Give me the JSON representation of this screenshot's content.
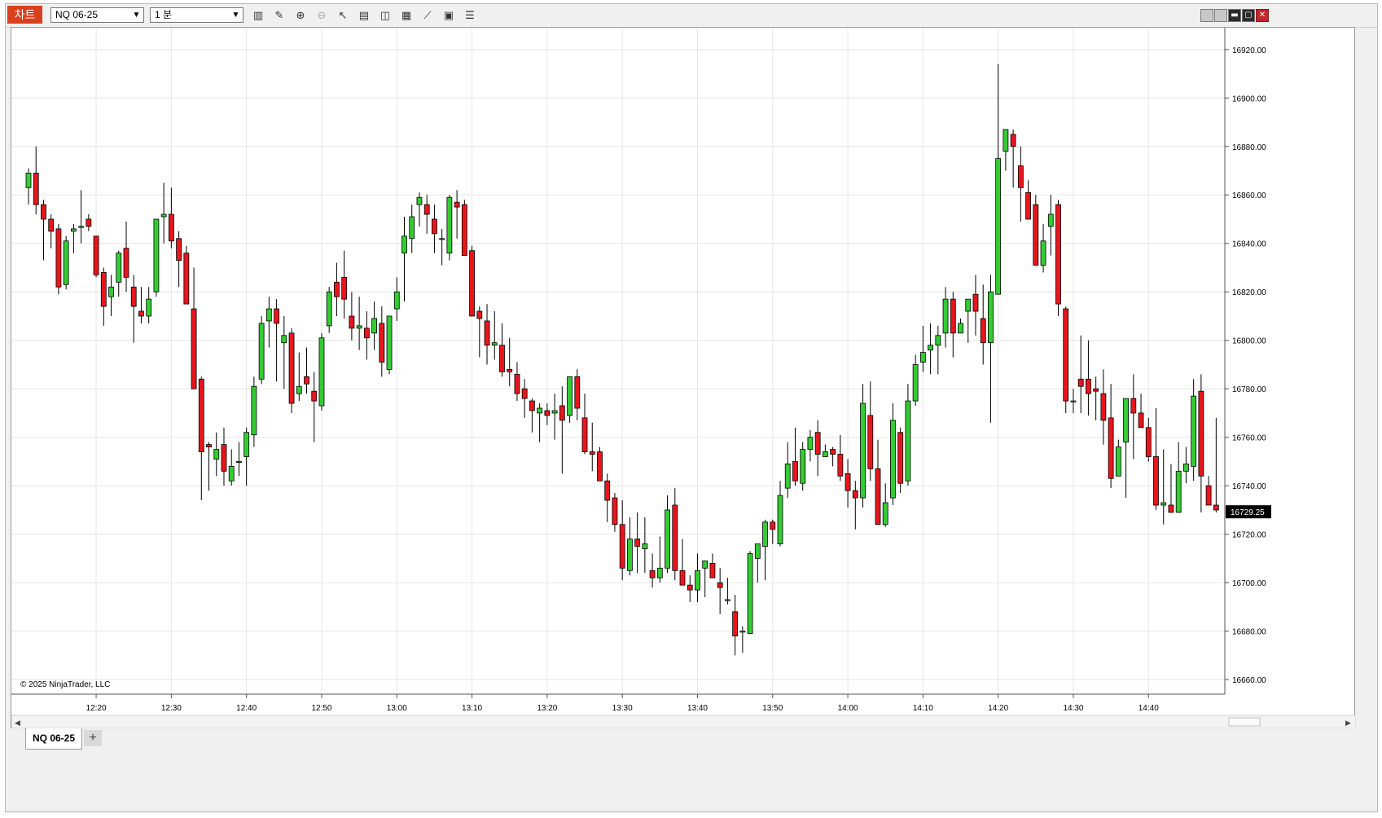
{
  "toolbar": {
    "brand_label": "차트",
    "instrument": "NQ 06-25",
    "interval": "1 분",
    "icons": [
      "bar-type-icon",
      "pencil-icon",
      "zoom-in-icon",
      "zoom-out-icon",
      "pointer-icon",
      "data-box-icon",
      "indicators-icon",
      "strategies-icon",
      "drawing-tools-icon",
      "properties-icon",
      "list-icon"
    ]
  },
  "window_controls": [
    "minimize-icon",
    "restore-icon",
    "maximize-icon",
    "close-icon"
  ],
  "tab": {
    "label": "NQ 06-25",
    "add_label": "+"
  },
  "copyright": "© 2025 NinjaTrader, LLC",
  "colors": {
    "up": "#33cc33",
    "down": "#e8161c",
    "price_marker": "#000000"
  },
  "chart_data": {
    "type": "candlestick",
    "instrument": "NQ 06-25",
    "interval": "1 분",
    "last_price": "16729.25",
    "ylim": [
      16654,
      16929
    ],
    "y_ticks": [
      "16660.00",
      "16680.00",
      "16700.00",
      "16720.00",
      "16740.00",
      "16760.00",
      "16780.00",
      "16800.00",
      "16820.00",
      "16840.00",
      "16860.00",
      "16880.00",
      "16900.00",
      "16920.00"
    ],
    "x_ticks": [
      "12:20",
      "12:30",
      "12:40",
      "12:50",
      "13:00",
      "13:10",
      "13:20",
      "13:30",
      "13:40",
      "13:50",
      "14:00",
      "14:10",
      "14:20",
      "14:30",
      "14:40"
    ],
    "x_tick_index": [
      9,
      19,
      29,
      39,
      49,
      59,
      69,
      79,
      89,
      99,
      109,
      119,
      129,
      139,
      149
    ],
    "candles": [
      [
        16863,
        16871,
        16856,
        16869
      ],
      [
        16869,
        16880,
        16852,
        16856
      ],
      [
        16856,
        16858,
        16833,
        16850
      ],
      [
        16850,
        16852,
        16838,
        16845
      ],
      [
        16846,
        16848,
        16819,
        16822
      ],
      [
        16823,
        16843,
        16821,
        16841
      ],
      [
        16845,
        16848,
        16836,
        16846
      ],
      [
        16847,
        16862,
        16840,
        16847
      ],
      [
        16850,
        16852,
        16845,
        16847
      ],
      [
        16843,
        16843,
        16826,
        16827
      ],
      [
        16828,
        16830,
        16806,
        16814
      ],
      [
        16818,
        16827,
        16810,
        16822
      ],
      [
        16824,
        16837,
        16818,
        16836
      ],
      [
        16838,
        16849,
        16820,
        16826
      ],
      [
        16822,
        16827,
        16799,
        16814
      ],
      [
        16812,
        16822,
        16807,
        16810
      ],
      [
        16810,
        16822,
        16807,
        16817
      ],
      [
        16820,
        16850,
        16818,
        16850
      ],
      [
        16851,
        16865,
        16840,
        16852
      ],
      [
        16852,
        16863,
        16838,
        16841
      ],
      [
        16842,
        16845,
        16822,
        16833
      ],
      [
        16836,
        16839,
        16818,
        16815
      ],
      [
        16813,
        16830,
        16810,
        16780
      ],
      [
        16784,
        16785,
        16734,
        16754
      ],
      [
        16757,
        16758,
        16738,
        16756
      ],
      [
        16751,
        16762,
        16744,
        16755
      ],
      [
        16757,
        16764,
        16740,
        16746
      ],
      [
        16742,
        16755,
        16740,
        16748
      ],
      [
        16750,
        16758,
        16744,
        16750
      ],
      [
        16752,
        16764,
        16740,
        16762
      ],
      [
        16761,
        16785,
        16756,
        16781
      ],
      [
        16784,
        16810,
        16782,
        16807
      ],
      [
        16808,
        16818,
        16797,
        16813
      ],
      [
        16813,
        16817,
        16783,
        16807
      ],
      [
        16799,
        16810,
        16780,
        16802
      ],
      [
        16803,
        16805,
        16770,
        16774
      ],
      [
        16778,
        16795,
        16775,
        16781
      ],
      [
        16785,
        16797,
        16778,
        16782
      ],
      [
        16779,
        16787,
        16758,
        16775
      ],
      [
        16773,
        16803,
        16771,
        16801
      ],
      [
        16806,
        16822,
        16803,
        16820
      ],
      [
        16824,
        16832,
        16810,
        16818
      ],
      [
        16826,
        16837,
        16809,
        16817
      ],
      [
        16810,
        16820,
        16800,
        16805
      ],
      [
        16805,
        16818,
        16796,
        16806
      ],
      [
        16805,
        16812,
        16792,
        16801
      ],
      [
        16803,
        16816,
        16796,
        16809
      ],
      [
        16807,
        16814,
        16785,
        16791
      ],
      [
        16788,
        16810,
        16786,
        16810
      ],
      [
        16813,
        16826,
        16808,
        16820
      ],
      [
        16836,
        16851,
        16816,
        16843
      ],
      [
        16842,
        16856,
        16836,
        16851
      ],
      [
        16856,
        16861,
        16847,
        16859
      ],
      [
        16856,
        16860,
        16844,
        16852
      ],
      [
        16850,
        16856,
        16836,
        16844
      ],
      [
        16842,
        16846,
        16831,
        16842
      ],
      [
        16836,
        16860,
        16833,
        16859
      ],
      [
        16857,
        16862,
        16842,
        16855
      ],
      [
        16856,
        16858,
        16836,
        16835
      ],
      [
        16837,
        16839,
        16813,
        16810
      ],
      [
        16812,
        16814,
        16793,
        16809
      ],
      [
        16808,
        16815,
        16790,
        16798
      ],
      [
        16798,
        16812,
        16792,
        16799
      ],
      [
        16798,
        16807,
        16785,
        16787
      ],
      [
        16788,
        16801,
        16781,
        16787
      ],
      [
        16786,
        16791,
        16775,
        16778
      ],
      [
        16780,
        16784,
        16768,
        16776
      ],
      [
        16775,
        16776,
        16762,
        16771
      ],
      [
        16770,
        16774,
        16758,
        16772
      ],
      [
        16771,
        16774,
        16765,
        16769
      ],
      [
        16770,
        16778,
        16759,
        16771
      ],
      [
        16773,
        16781,
        16745,
        16767
      ],
      [
        16769,
        16785,
        16766,
        16785
      ],
      [
        16785,
        16788,
        16767,
        16772
      ],
      [
        16768,
        16778,
        16753,
        16754
      ],
      [
        16754,
        16766,
        16746,
        16753
      ],
      [
        16754,
        16756,
        16742,
        16742
      ],
      [
        16742,
        16745,
        16725,
        16734
      ],
      [
        16735,
        16737,
        16721,
        16724
      ],
      [
        16724,
        16734,
        16701,
        16706
      ],
      [
        16705,
        16727,
        16703,
        16718
      ],
      [
        16718,
        16729,
        16704,
        16715
      ],
      [
        16714,
        16727,
        16704,
        16716
      ],
      [
        16705,
        16712,
        16698,
        16702
      ],
      [
        16702,
        16719,
        16700,
        16706
      ],
      [
        16706,
        16736,
        16704,
        16730
      ],
      [
        16732,
        16739,
        16701,
        16705
      ],
      [
        16705,
        16718,
        16699,
        16699
      ],
      [
        16699,
        16703,
        16692,
        16697
      ],
      [
        16697,
        16712,
        16692,
        16705
      ],
      [
        16706,
        16707,
        16694,
        16709
      ],
      [
        16708,
        16712,
        16706,
        16702
      ],
      [
        16700,
        16706,
        16687,
        16698
      ],
      [
        16693,
        16702,
        16691,
        16693
      ],
      [
        16688,
        16695,
        16670,
        16678
      ],
      [
        16680,
        16682,
        16671,
        16680
      ],
      [
        16679,
        16713,
        16680,
        16712
      ],
      [
        16710,
        16716,
        16700,
        16716
      ],
      [
        16715,
        16726,
        16701,
        16725
      ],
      [
        16725,
        16726,
        16716,
        16722
      ],
      [
        16716,
        16742,
        16715,
        16736
      ],
      [
        16739,
        16758,
        16735,
        16749
      ],
      [
        16750,
        16764,
        16740,
        16742
      ],
      [
        16741,
        16758,
        16738,
        16755
      ],
      [
        16755,
        16763,
        16750,
        16760
      ],
      [
        16762,
        16767,
        16744,
        16753
      ],
      [
        16752,
        16757,
        16752,
        16754
      ],
      [
        16755,
        16756,
        16748,
        16753
      ],
      [
        16753,
        16761,
        16742,
        16744
      ],
      [
        16745,
        16751,
        16731,
        16738
      ],
      [
        16738,
        16742,
        16722,
        16735
      ],
      [
        16735,
        16782,
        16731,
        16774
      ],
      [
        16769,
        16783,
        16742,
        16747
      ],
      [
        16747,
        16759,
        16724,
        16724
      ],
      [
        16724,
        16741,
        16723,
        16733
      ],
      [
        16735,
        16774,
        16732,
        16767
      ],
      [
        16762,
        16764,
        16737,
        16741
      ],
      [
        16742,
        16782,
        16740,
        16775
      ],
      [
        16775,
        16794,
        16773,
        16790
      ],
      [
        16791,
        16806,
        16787,
        16795
      ],
      [
        16796,
        16807,
        16786,
        16798
      ],
      [
        16798,
        16806,
        16786,
        16802
      ],
      [
        16803,
        16822,
        16797,
        16817
      ],
      [
        16817,
        16820,
        16793,
        16803
      ],
      [
        16803,
        16809,
        16803,
        16807
      ],
      [
        16812,
        16817,
        16799,
        16817
      ],
      [
        16819,
        16827,
        16802,
        16812
      ],
      [
        16809,
        16823,
        16790,
        16799
      ],
      [
        16799,
        16827,
        16766,
        16820
      ],
      [
        16819,
        16914,
        16819,
        16875
      ],
      [
        16878,
        16886,
        16870,
        16887
      ],
      [
        16885,
        16887,
        16863,
        16880
      ],
      [
        16872,
        16880,
        16849,
        16863
      ],
      [
        16861,
        16866,
        16854,
        16850
      ],
      [
        16856,
        16860,
        16834,
        16831
      ],
      [
        16831,
        16848,
        16828,
        16841
      ],
      [
        16847,
        16860,
        16835,
        16852
      ],
      [
        16856,
        16858,
        16810,
        16815
      ],
      [
        16813,
        16814,
        16770,
        16775
      ],
      [
        16775,
        16780,
        16770,
        16775
      ],
      [
        16784,
        16802,
        16770,
        16781
      ],
      [
        16784,
        16800,
        16769,
        16778
      ],
      [
        16780,
        16785,
        16767,
        16779
      ],
      [
        16778,
        16788,
        16757,
        16767
      ],
      [
        16768,
        16782,
        16739,
        16743
      ],
      [
        16744,
        16759,
        16747,
        16756
      ],
      [
        16758,
        16775,
        16735,
        16776
      ],
      [
        16776,
        16786,
        16751,
        16770
      ],
      [
        16770,
        16778,
        16765,
        16764
      ],
      [
        16764,
        16768,
        16750,
        16752
      ],
      [
        16752,
        16772,
        16730,
        16732
      ],
      [
        16732,
        16755,
        16724,
        16733
      ],
      [
        16732,
        16749,
        16730,
        16729
      ],
      [
        16729,
        16758,
        16730,
        16746
      ],
      [
        16746,
        16756,
        16741,
        16749
      ],
      [
        16748,
        16784,
        16742,
        16777
      ],
      [
        16779,
        16786,
        16729,
        16744
      ],
      [
        16740,
        16744,
        16734,
        16732
      ],
      [
        16732,
        16768,
        16729,
        16730
      ]
    ]
  }
}
